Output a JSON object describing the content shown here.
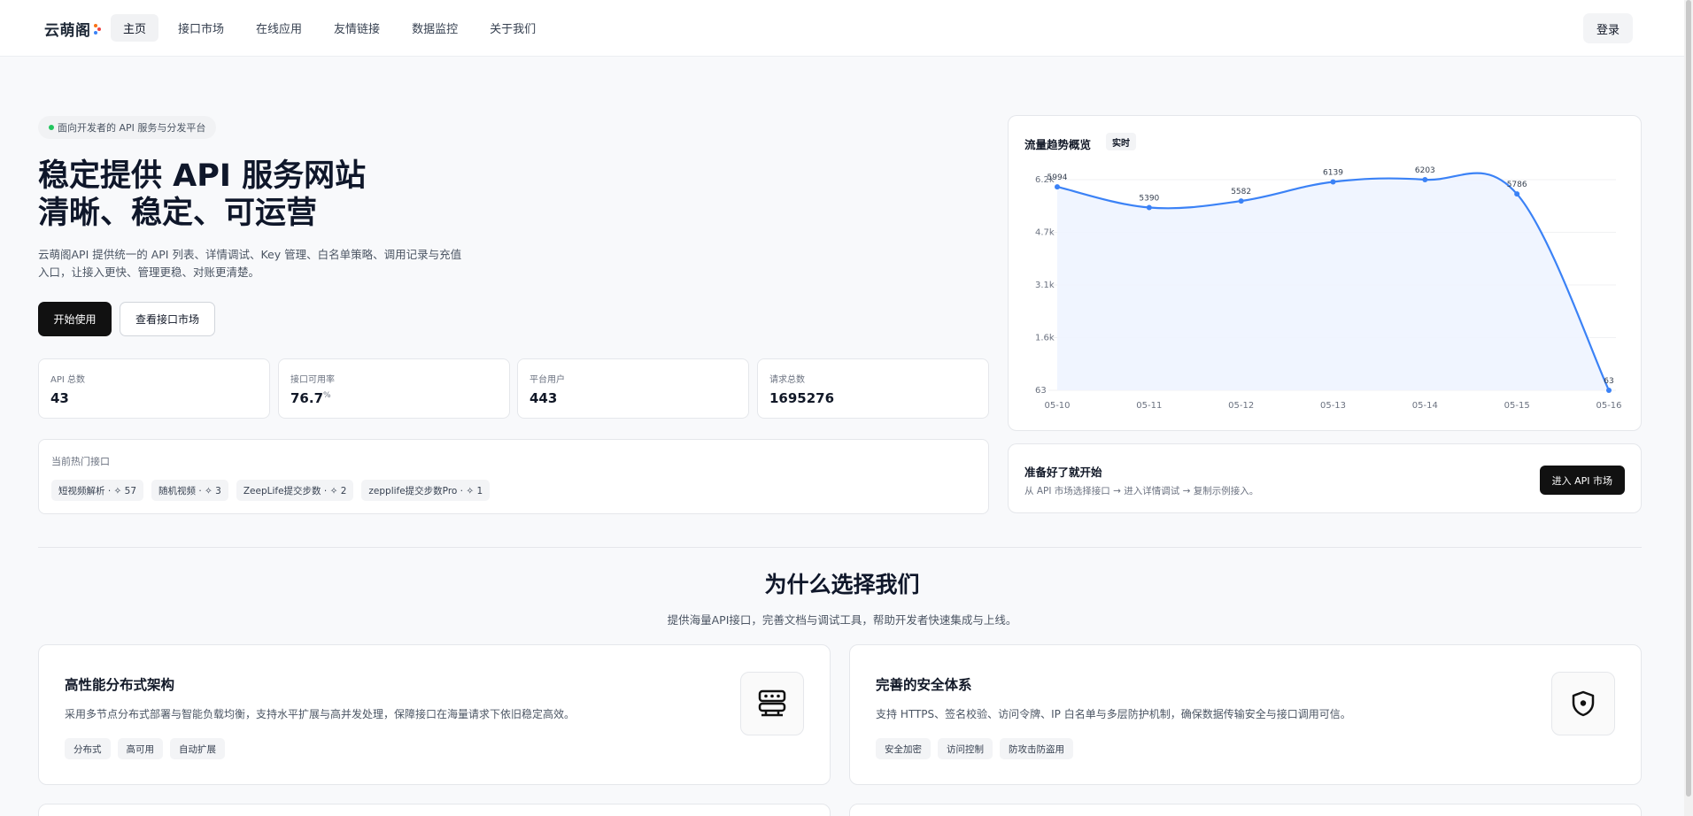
{
  "header": {
    "logo_text": "云萌阁",
    "nav": [
      "主页",
      "接口市场",
      "在线应用",
      "友情链接",
      "数据监控",
      "关于我们"
    ],
    "login_label": "登录"
  },
  "hero": {
    "badge": "面向开发者的 API 服务与分发平台",
    "title_line1": "稳定提供 API 服务网站",
    "title_line2": "清晰、稳定、可运营",
    "desc": "云萌阁API 提供统一的 API 列表、详情调试、Key 管理、白名单策略、调用记录与充值入口，让接入更快、管理更稳、对账更清楚。",
    "start_label": "开始使用",
    "market_label": "查看接口市场"
  },
  "stats": [
    {
      "label": "API 总数",
      "value": "43",
      "unit": ""
    },
    {
      "label": "接口可用率",
      "value": "76.7",
      "unit": "%"
    },
    {
      "label": "平台用户",
      "value": "443",
      "unit": ""
    },
    {
      "label": "请求总数",
      "value": "1695276",
      "unit": ""
    }
  ],
  "hot": {
    "label": "当前热门接口",
    "tags": [
      "短视频解析 · ✧ 57",
      "随机视频 · ✧ 3",
      "ZeepLife提交步数 · ✧ 2",
      "zepplife提交步数Pro · ✧ 1"
    ]
  },
  "chart": {
    "title": "流量趋势概览",
    "badge": "实时"
  },
  "chart_data": {
    "type": "area",
    "x": [
      "05-10",
      "05-11",
      "05-12",
      "05-13",
      "05-14",
      "05-15",
      "05-16"
    ],
    "values": [
      5994,
      5390,
      5582,
      6139,
      6203,
      5786,
      63
    ],
    "y_ticks": [
      "63",
      "1.6k",
      "3.1k",
      "4.7k",
      "6.2k"
    ],
    "ylim": [
      63,
      6203
    ],
    "line_color": "#3b82f6",
    "fill_color": "#eef4ff",
    "grid": true
  },
  "ready": {
    "title": "准备好了就开始",
    "sub": "从 API 市场选择接口 → 进入详情调试 → 复制示例接入。",
    "button": "进入 API 市场"
  },
  "why": {
    "title": "为什么选择我们",
    "sub": "提供海量API接口，完善文档与调试工具，帮助开发者快速集成与上线。"
  },
  "features": [
    {
      "title": "高性能分布式架构",
      "desc": "采用多节点分布式部署与智能负载均衡，支持水平扩展与高并发处理，保障接口在海量请求下依旧稳定高效。",
      "tags": [
        "分布式",
        "高可用",
        "自动扩展"
      ],
      "icon": "server-icon"
    },
    {
      "title": "完善的安全体系",
      "desc": "支持 HTTPS、签名校验、访问令牌、IP 白名单与多层防护机制，确保数据传输安全与接口调用可信。",
      "tags": [
        "安全加密",
        "访问控制",
        "防攻击防盗用"
      ],
      "icon": "shield-icon"
    }
  ]
}
